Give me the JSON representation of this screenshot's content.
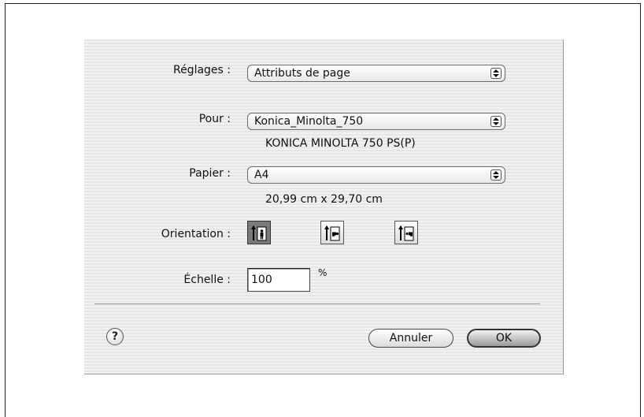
{
  "dialog": {
    "settings": {
      "label": "Réglages :",
      "value": "Attributs de page"
    },
    "format_for": {
      "label": "Pour :",
      "value": "Konica_Minolta_750",
      "printer_model": "KONICA MINOLTA 750 PS(P)"
    },
    "paper": {
      "label": "Papier :",
      "value": "A4",
      "dimensions": "20,99 cm x 29,70 cm"
    },
    "orientation": {
      "label": "Orientation :",
      "options": [
        {
          "name": "portrait",
          "icon": "portrait-orientation-icon",
          "selected": true
        },
        {
          "name": "landscape-left",
          "icon": "landscape-left-orientation-icon",
          "selected": false
        },
        {
          "name": "landscape-right",
          "icon": "landscape-right-orientation-icon",
          "selected": false
        }
      ]
    },
    "scale": {
      "label": "Échelle :",
      "value": "100",
      "unit": "%"
    },
    "help": {
      "symbol": "?"
    },
    "buttons": {
      "cancel": "Annuler",
      "ok": "OK"
    }
  }
}
